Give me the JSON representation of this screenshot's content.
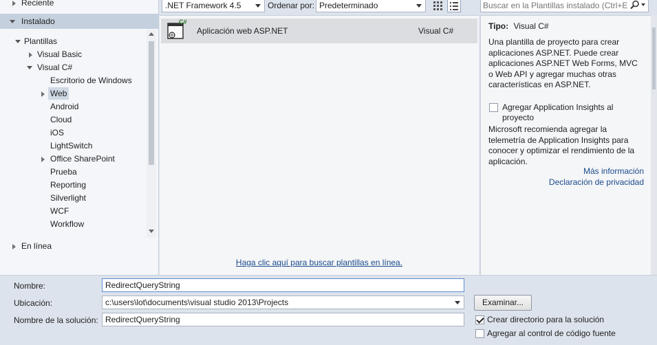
{
  "left_nav": {
    "recent": "Reciente",
    "installed": "Instalado",
    "templates": "Plantillas",
    "visual_basic": "Visual Basic",
    "visual_csharp": "Visual C#",
    "items": [
      "Escritorio de Windows",
      "Web",
      "Android",
      "Cloud",
      "iOS",
      "LightSwitch",
      "Office SharePoint",
      "Prueba",
      "Reporting",
      "Silverlight",
      "WCF",
      "Workflow"
    ],
    "online": "En línea"
  },
  "toolbar": {
    "framework": ".NET Framework 4.5",
    "sort_label": "Ordenar por:",
    "sort_value": "Predeterminado",
    "search_placeholder": "Buscar en la Plantillas instalado (Ctrl+E)"
  },
  "templates": [
    {
      "name": "Aplicación web ASP.NET",
      "language": "Visual C#",
      "badge": "C#"
    }
  ],
  "online_link": "Haga clic aquí para buscar plantillas en línea.",
  "info": {
    "type_label": "Tipo:",
    "type_value": "Visual C#",
    "description": "Una plantilla de proyecto para crear aplicaciones ASP.NET. Puede crear aplicaciones ASP.NET Web Forms, MVC o Web API y agregar muchas otras características en ASP.NET.",
    "insights_checkbox": "Agregar Application Insights al proyecto",
    "insights_checked": false,
    "ms_text": "Microsoft recomienda agregar la telemetría de Application Insights para conocer y optimizar el rendimiento de la aplicación.",
    "more_info": "Más información",
    "privacy": "Declaración de privacidad"
  },
  "form": {
    "name_label": "Nombre:",
    "name_value": "RedirectQueryString",
    "location_label": "Ubicación:",
    "location_value": "c:\\users\\lot\\documents\\visual studio 2013\\Projects",
    "solution_label": "Nombre de la solución:",
    "solution_value": "RedirectQueryString",
    "browse": "Examinar...",
    "create_dir": "Crear directorio para la solución",
    "create_dir_checked": true,
    "source_control": "Agregar al control de código fuente",
    "source_control_checked": false
  },
  "colors": {
    "link": "#1a4b8c",
    "background": "#dde3ec",
    "selection": "#c5d0de"
  }
}
